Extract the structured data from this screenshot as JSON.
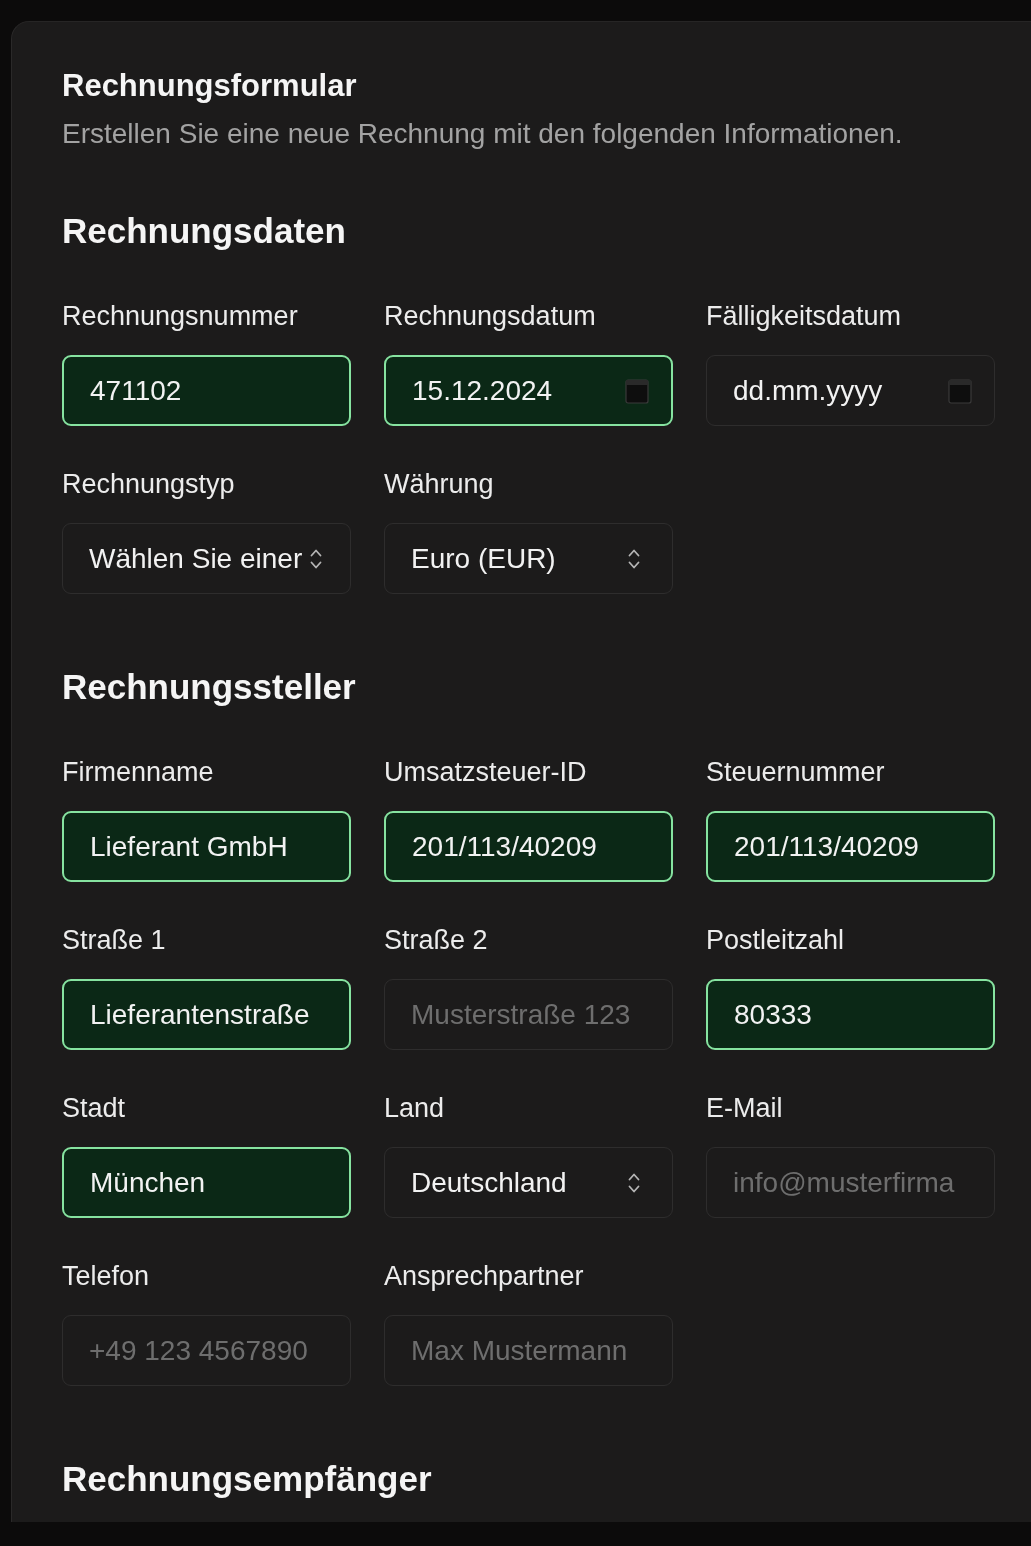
{
  "form": {
    "title": "Rechnungsformular",
    "description": "Erstellen Sie eine neue Rechnung mit den folgenden Informationen."
  },
  "sections": [
    {
      "heading": "Rechnungsdaten",
      "fields": [
        {
          "label": "Rechnungsnummer",
          "kind": "text",
          "value": "471102",
          "valid": true
        },
        {
          "label": "Rechnungsdatum",
          "kind": "date",
          "value": "15.12.2024",
          "valid": true
        },
        {
          "label": "Fälligkeitsdatum",
          "kind": "date",
          "placeholder": "dd.mm.yyyy",
          "valid": false
        },
        {
          "label": "Rechnungstyp",
          "kind": "select",
          "value": "Wählen Sie einer",
          "valid": false
        },
        {
          "label": "Währung",
          "kind": "select",
          "value": "Euro (EUR)",
          "valid": false
        }
      ]
    },
    {
      "heading": "Rechnungssteller",
      "fields": [
        {
          "label": "Firmenname",
          "kind": "text",
          "value": "Lieferant GmbH",
          "valid": true
        },
        {
          "label": "Umsatzsteuer-ID",
          "kind": "text",
          "value": "201/113/40209",
          "valid": true
        },
        {
          "label": "Steuernummer",
          "kind": "text",
          "value": "201/113/40209",
          "valid": true
        },
        {
          "label": "Straße 1",
          "kind": "text",
          "value": "Lieferantenstraße",
          "valid": true
        },
        {
          "label": "Straße 2",
          "kind": "text",
          "placeholder": "Musterstraße 123",
          "valid": false
        },
        {
          "label": "Postleitzahl",
          "kind": "text",
          "value": "80333",
          "valid": true
        },
        {
          "label": "Stadt",
          "kind": "text",
          "value": "München",
          "valid": true
        },
        {
          "label": "Land",
          "kind": "select",
          "value": "Deutschland",
          "valid": false
        },
        {
          "label": "E-Mail",
          "kind": "text",
          "placeholder": "info@musterfirma",
          "valid": false
        },
        {
          "label": "Telefon",
          "kind": "text",
          "placeholder": "+49 123 4567890",
          "valid": false
        },
        {
          "label": "Ansprechpartner",
          "kind": "text",
          "placeholder": "Max Mustermann",
          "valid": false
        }
      ]
    },
    {
      "heading": "Rechnungsempfänger"
    }
  ]
}
